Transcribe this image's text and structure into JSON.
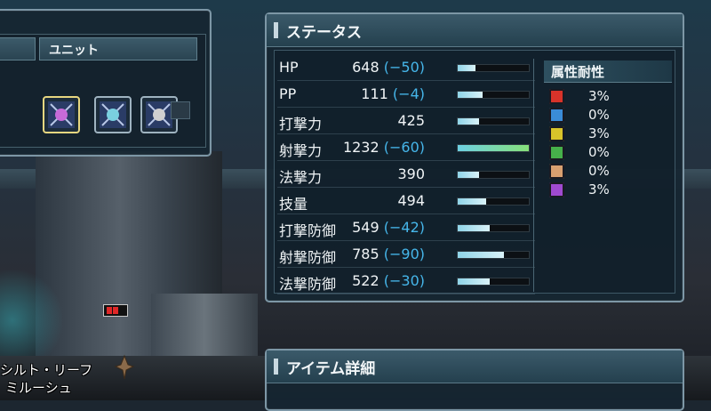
{
  "unit_panel": {
    "tabs": [
      "",
      "ユニット"
    ],
    "slots": [
      {
        "icon": "rear-unit-icon",
        "selected": true
      },
      {
        "icon": "arm-unit-icon",
        "selected": false
      },
      {
        "icon": "leg-unit-icon",
        "selected": false
      }
    ]
  },
  "status": {
    "title": "ステータス",
    "stats": [
      {
        "name": "HP",
        "value": "648",
        "mod": "(−50)",
        "fill": 0.25
      },
      {
        "name": "PP",
        "value": "111",
        "mod": "(−4)",
        "fill": 0.35
      },
      {
        "name": "打撃力",
        "value": "425",
        "mod": "",
        "fill": 0.3
      },
      {
        "name": "射撃力",
        "value": "1232",
        "mod": "(−60)",
        "fill": 1.0
      },
      {
        "name": "法撃力",
        "value": "390",
        "mod": "",
        "fill": 0.3
      },
      {
        "name": "技量",
        "value": "494",
        "mod": "",
        "fill": 0.4
      },
      {
        "name": "打撃防御",
        "value": "549",
        "mod": "(−42)",
        "fill": 0.45
      },
      {
        "name": "射撃防御",
        "value": "785",
        "mod": "(−90)",
        "fill": 0.65
      },
      {
        "name": "法撃防御",
        "value": "522",
        "mod": "(−30)",
        "fill": 0.45
      }
    ],
    "resist_title": "属性耐性",
    "resists": [
      {
        "element": "fire",
        "icon": "fire-element-icon",
        "value": "3%",
        "color": "#d8332a"
      },
      {
        "element": "ice",
        "icon": "ice-element-icon",
        "value": "0%",
        "color": "#3a8cd8"
      },
      {
        "element": "lightning",
        "icon": "lightning-element-icon",
        "value": "3%",
        "color": "#d8c42a"
      },
      {
        "element": "wind",
        "icon": "wind-element-icon",
        "value": "0%",
        "color": "#46b04a"
      },
      {
        "element": "light",
        "icon": "light-element-icon",
        "value": "0%",
        "color": "#d8a070"
      },
      {
        "element": "dark",
        "icon": "dark-element-icon",
        "value": "3%",
        "color": "#a04ad0"
      }
    ]
  },
  "item_panel": {
    "title": "アイテム詳細"
  },
  "character": {
    "name_line1": "シルト・リーフ",
    "name_line2": "ミルーシュ"
  }
}
